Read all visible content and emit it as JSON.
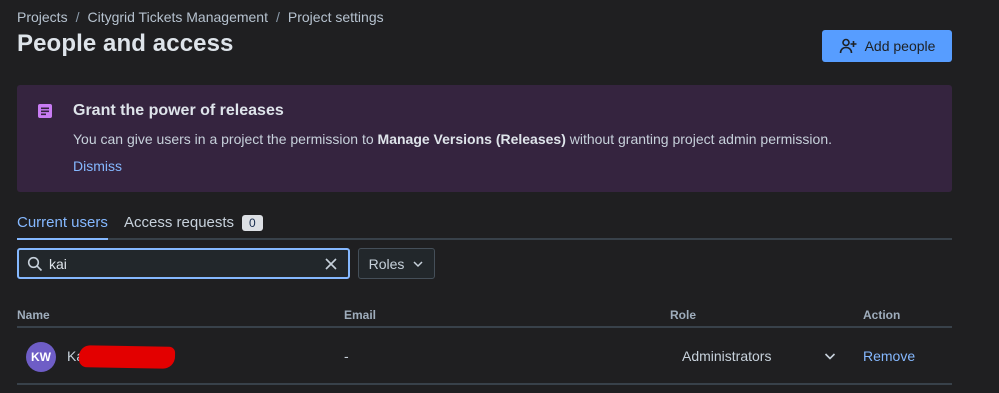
{
  "breadcrumb": {
    "items": [
      "Projects",
      "Citygrid Tickets Management",
      "Project settings"
    ],
    "separator": "/"
  },
  "page": {
    "title": "People and access"
  },
  "actions": {
    "add_people_label": "Add people"
  },
  "banner": {
    "title": "Grant the power of releases",
    "body_prefix": "You can give users in a project the permission to ",
    "body_bold": "Manage Versions (Releases)",
    "body_suffix": " without granting project admin permission.",
    "dismiss_label": "Dismiss",
    "icon": "release-notes-icon"
  },
  "tabs": {
    "current_users": "Current users",
    "access_requests": "Access requests",
    "access_requests_count": "0"
  },
  "filters": {
    "search_value": "kai",
    "roles_label": "Roles"
  },
  "table": {
    "headers": {
      "name": "Name",
      "email": "Email",
      "role": "Role",
      "action": "Action"
    },
    "rows": [
      {
        "initials": "KW",
        "name": "Ka",
        "email": "-",
        "role": "Administrators",
        "action": "Remove"
      }
    ]
  },
  "colors": {
    "background": "#1f1f21",
    "accent": "#579dff",
    "link": "#85b8ff",
    "banner_bg": "#35243f",
    "banner_icon": "#c97cf4",
    "avatar_bg": "#6e5dc6",
    "redaction": "#e30000"
  }
}
